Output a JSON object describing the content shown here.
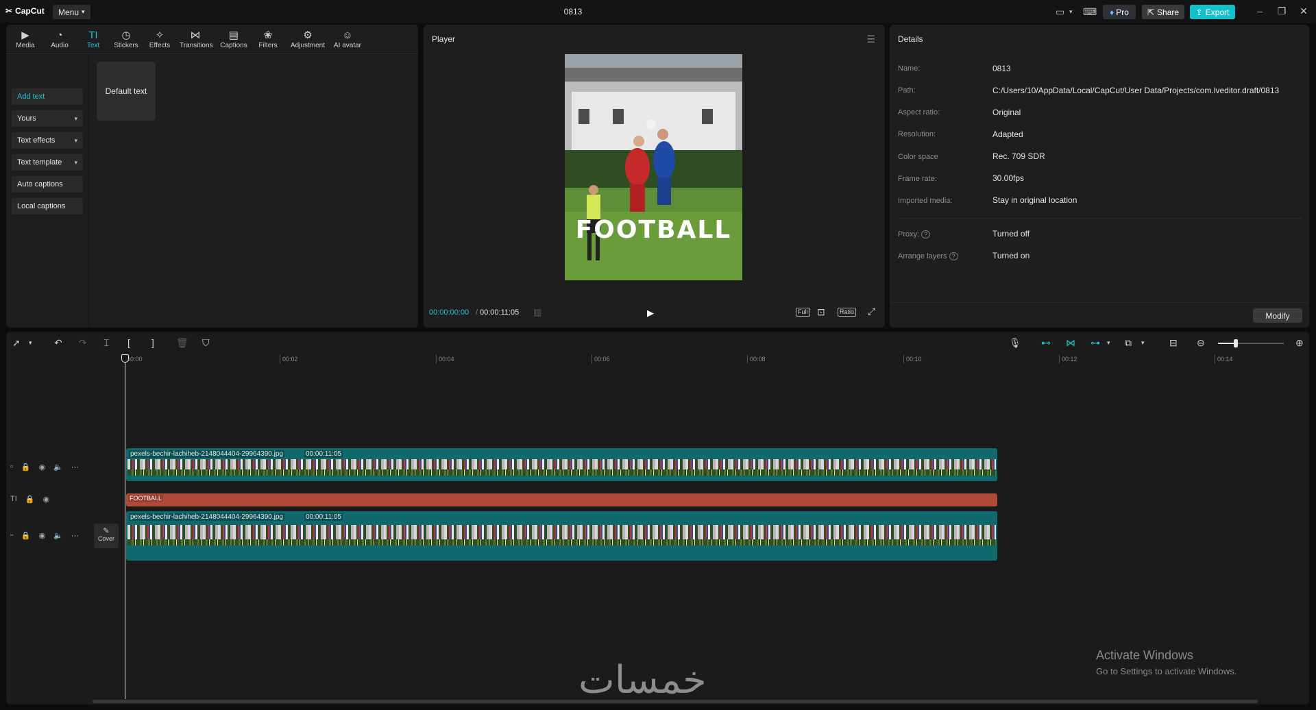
{
  "app": {
    "name": "CapCut",
    "menu_label": "Menu",
    "project_title": "0813"
  },
  "titlebar": {
    "pro_label": "Pro",
    "share_label": "Share",
    "export_label": "Export"
  },
  "tabs": [
    {
      "label": "Media",
      "icon": "media-icon"
    },
    {
      "label": "Audio",
      "icon": "audio-icon"
    },
    {
      "label": "Text",
      "icon": "text-icon",
      "active": true
    },
    {
      "label": "Stickers",
      "icon": "stickers-icon"
    },
    {
      "label": "Effects",
      "icon": "effects-icon"
    },
    {
      "label": "Transitions",
      "icon": "transitions-icon"
    },
    {
      "label": "Captions",
      "icon": "captions-icon"
    },
    {
      "label": "Filters",
      "icon": "filters-icon"
    },
    {
      "label": "Adjustment",
      "icon": "adjustment-icon"
    },
    {
      "label": "AI avatar",
      "icon": "ai-avatar-icon"
    }
  ],
  "sidebar": {
    "items": [
      {
        "label": "Add text"
      },
      {
        "label": "Yours"
      },
      {
        "label": "Text effects"
      },
      {
        "label": "Text template"
      },
      {
        "label": "Auto captions"
      },
      {
        "label": "Local captions"
      }
    ]
  },
  "text_panel": {
    "default_card": "Default text"
  },
  "player": {
    "title": "Player",
    "current_time": "00:00:00:00",
    "total_time": "00:00:11:05",
    "overlay_text": "FOOTBALL",
    "controls": {
      "full": "Full",
      "ratio": "Ratio"
    }
  },
  "details": {
    "title": "Details",
    "rows": [
      {
        "label": "Name:",
        "value": "0813"
      },
      {
        "label": "Path:",
        "value": "C:/Users/10/AppData/Local/CapCut/User Data/Projects/com.lveditor.draft/0813"
      },
      {
        "label": "Aspect ratio:",
        "value": "Original"
      },
      {
        "label": "Resolution:",
        "value": "Adapted"
      },
      {
        "label": "Color space",
        "value": "Rec. 709 SDR"
      },
      {
        "label": "Frame rate:",
        "value": "30.00fps"
      },
      {
        "label": "Imported media:",
        "value": "Stay in original location"
      },
      {
        "label": "Proxy:",
        "value": "Turned off"
      },
      {
        "label": "Arrange layers",
        "value": "Turned on"
      }
    ],
    "modify_label": "Modify"
  },
  "timeline": {
    "ruler": [
      "00:00",
      "00:02",
      "00:04",
      "00:06",
      "00:08",
      "00:10",
      "00:12",
      "00:14"
    ],
    "video_clip_top": {
      "name": "pexels-bechir-lachiheb-2148044404-29964390.jpg",
      "duration": "00:00:11:05"
    },
    "text_clip": {
      "label": "FOOTBALL"
    },
    "video_clip_main": {
      "name": "pexels-bechir-lachiheb-2148044404-29964390.jpg",
      "duration": "00:00:11:05"
    },
    "cover_label": "Cover"
  },
  "watermark": {
    "activate_title": "Activate Windows",
    "activate_sub": "Go to Settings to activate Windows.",
    "logo_text": "خمسات"
  },
  "colors": {
    "accent": "#20c5d2",
    "text_clip": "#b04a38",
    "video_clip": "#0f6a6e"
  }
}
